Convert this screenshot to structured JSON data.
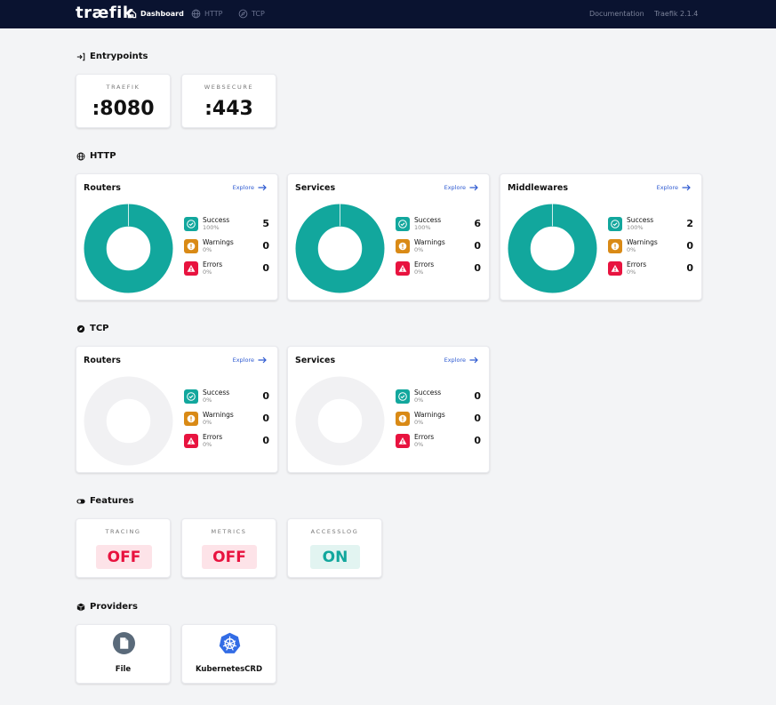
{
  "topbar": {
    "logo": "træfik",
    "nav": {
      "dashboard": "Dashboard",
      "http": "HTTP",
      "tcp": "TCP"
    },
    "documentation": "Documentation",
    "version": "Traefik 2.1.4"
  },
  "entrypoints": {
    "title": "Entrypoints",
    "items": [
      {
        "name": "TRAEFIK",
        "port": ":8080"
      },
      {
        "name": "WEBSECURE",
        "port": ":443"
      }
    ]
  },
  "http": {
    "title": "HTTP",
    "cards": [
      {
        "title": "Routers",
        "explore": "Explore",
        "success": {
          "label": "Success",
          "pct": "100%",
          "count": "5",
          "fraction": 1
        },
        "warnings": {
          "label": "Warnings",
          "pct": "0%",
          "count": "0"
        },
        "errors": {
          "label": "Errors",
          "pct": "0%",
          "count": "0"
        }
      },
      {
        "title": "Services",
        "explore": "Explore",
        "success": {
          "label": "Success",
          "pct": "100%",
          "count": "6",
          "fraction": 1
        },
        "warnings": {
          "label": "Warnings",
          "pct": "0%",
          "count": "0"
        },
        "errors": {
          "label": "Errors",
          "pct": "0%",
          "count": "0"
        }
      },
      {
        "title": "Middlewares",
        "explore": "Explore",
        "success": {
          "label": "Success",
          "pct": "100%",
          "count": "2",
          "fraction": 1
        },
        "warnings": {
          "label": "Warnings",
          "pct": "0%",
          "count": "0"
        },
        "errors": {
          "label": "Errors",
          "pct": "0%",
          "count": "0"
        }
      }
    ]
  },
  "tcp": {
    "title": "TCP",
    "cards": [
      {
        "title": "Routers",
        "explore": "Explore",
        "success": {
          "label": "Success",
          "pct": "0%",
          "count": "0",
          "fraction": 0
        },
        "warnings": {
          "label": "Warnings",
          "pct": "0%",
          "count": "0"
        },
        "errors": {
          "label": "Errors",
          "pct": "0%",
          "count": "0"
        }
      },
      {
        "title": "Services",
        "explore": "Explore",
        "success": {
          "label": "Success",
          "pct": "0%",
          "count": "0",
          "fraction": 0
        },
        "warnings": {
          "label": "Warnings",
          "pct": "0%",
          "count": "0"
        },
        "errors": {
          "label": "Errors",
          "pct": "0%",
          "count": "0"
        }
      }
    ]
  },
  "features": {
    "title": "Features",
    "items": [
      {
        "name": "TRACING",
        "status": "OFF"
      },
      {
        "name": "METRICS",
        "status": "OFF"
      },
      {
        "name": "ACCESSLOG",
        "status": "ON"
      }
    ]
  },
  "providers": {
    "title": "Providers",
    "items": [
      {
        "name": "File",
        "icon": "file-icon"
      },
      {
        "name": "KubernetesCRD",
        "icon": "kubernetes-icon"
      }
    ]
  },
  "colors": {
    "success": "#12a79d",
    "warning": "#d98a16",
    "error": "#e8133f",
    "empty": "#f1f1f3",
    "topbar": "#0a1330",
    "link": "#2f5bd1"
  }
}
